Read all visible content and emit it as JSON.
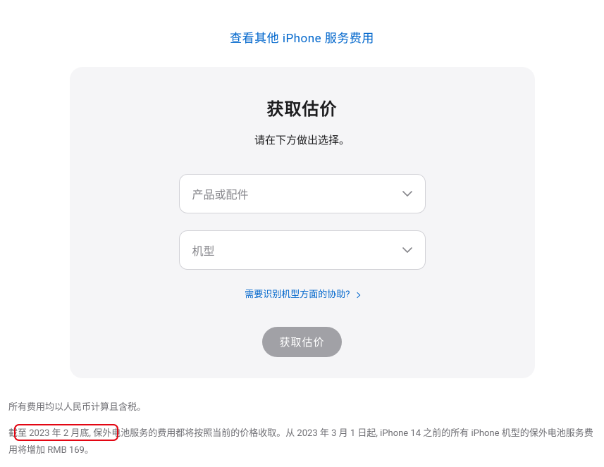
{
  "top_link": "查看其他 iPhone 服务费用",
  "card": {
    "title": "获取估价",
    "subtitle": "请在下方做出选择。",
    "select1_placeholder": "产品或配件",
    "select2_placeholder": "机型",
    "help_link": "需要识别机型方面的协助?",
    "submit_label": "获取估价"
  },
  "footnotes": {
    "line1": "所有费用均以人民币计算且含税。",
    "line2": "截至 2023 年 2 月底, 保外电池服务的费用都将按照当前的价格收取。从 2023 年 3 月 1 日起, iPhone 14 之前的所有 iPhone 机型的保外电池服务费用将增加 RMB 169。"
  }
}
